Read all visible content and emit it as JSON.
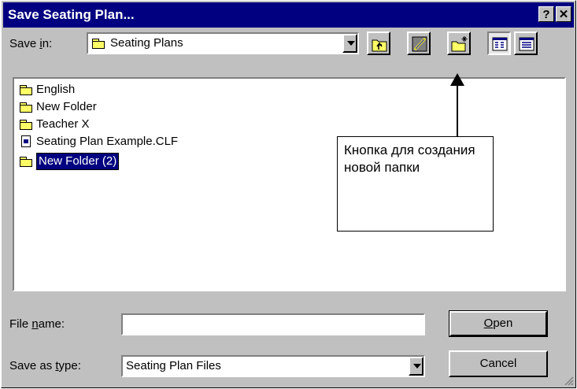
{
  "window": {
    "title": "Save Seating Plan..."
  },
  "titlebar_buttons": {
    "help": "?",
    "close": "✕"
  },
  "save_in": {
    "label_prefix": "Save ",
    "label_hotkey": "i",
    "label_suffix": "n:",
    "value": "Seating Plans"
  },
  "toolbar": {
    "icons": [
      "up-one-level-icon",
      "desktop-icon",
      "new-folder-icon",
      "list-view-icon",
      "details-view-icon"
    ]
  },
  "files": [
    {
      "name": "English",
      "type": "folder"
    },
    {
      "name": "New Folder",
      "type": "folder"
    },
    {
      "name": "Teacher X",
      "type": "folder"
    },
    {
      "name": "Seating Plan Example.CLF",
      "type": "file"
    },
    {
      "name": "New Folder (2)",
      "type": "folder",
      "editing": true
    }
  ],
  "annotation": {
    "text": "Кнопка для создания новой папки"
  },
  "file_name": {
    "label_prefix": "File ",
    "label_hotkey": "n",
    "label_suffix": "ame:",
    "value": ""
  },
  "save_as_type": {
    "label_prefix": "Save as ",
    "label_hotkey": "t",
    "label_suffix": "ype:",
    "value": "Seating Plan Files"
  },
  "buttons": {
    "open_hotkey": "O",
    "open_rest": "pen",
    "cancel": "Cancel"
  }
}
